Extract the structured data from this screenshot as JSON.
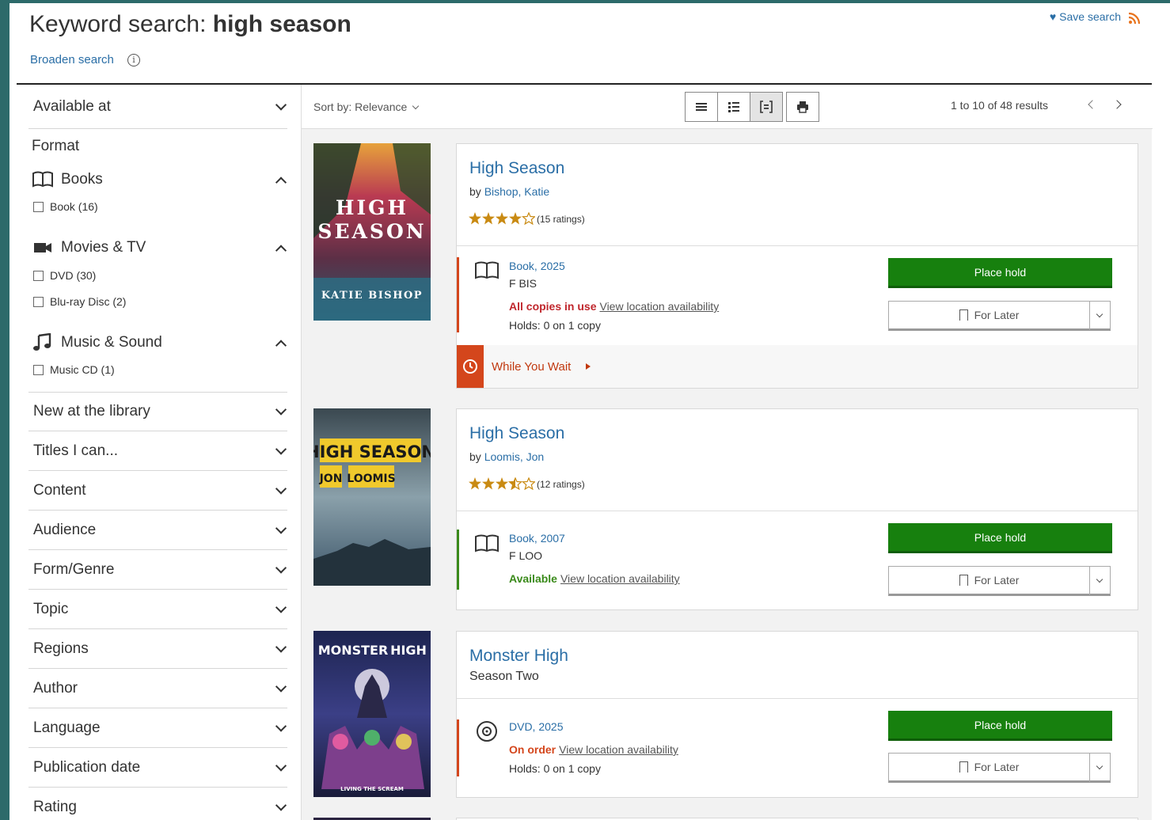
{
  "header": {
    "title_prefix": "Keyword search:",
    "title_query": "high season",
    "broaden_label": "Broaden search",
    "save_search_label": "Save search"
  },
  "sidebar": {
    "available_at": "Available at",
    "format_heading": "Format",
    "groups": [
      {
        "label": "Books",
        "options": [
          "Book (16)"
        ]
      },
      {
        "label": "Movies & TV",
        "options": [
          "DVD (30)",
          "Blu-ray Disc (2)"
        ]
      },
      {
        "label": "Music & Sound",
        "options": [
          "Music CD (1)"
        ]
      }
    ],
    "facets": [
      "New at the library",
      "Titles I can...",
      "Content",
      "Audience",
      "Form/Genre",
      "Topic",
      "Regions",
      "Author",
      "Language",
      "Publication date",
      "Rating"
    ]
  },
  "toolbar": {
    "sort_label": "Sort by: Relevance",
    "results_count": "1 to 10 of 48 results"
  },
  "results": [
    {
      "title": "High Season",
      "by_prefix": "by",
      "author": "Bishop, Katie",
      "rating_stars": 4,
      "ratings_text": "(15 ratings)",
      "format": "Book, 2025",
      "call_number": "F BIS",
      "status": "All copies in use",
      "status_color": "#c0272d",
      "availability_link": "View location availability",
      "holds": "Holds: 0 on 1 copy",
      "place_hold": "Place hold",
      "for_later": "For Later",
      "while_you_wait": "While You Wait",
      "cover_text": [
        "HIGH",
        "SEASON",
        "KATIE BISHOP"
      ]
    },
    {
      "title": "High Season",
      "by_prefix": "by",
      "author": "Loomis, Jon",
      "rating_stars": 3.5,
      "ratings_text": "(12 ratings)",
      "format": "Book, 2007",
      "call_number": "F LOO",
      "status": "Available",
      "status_color": "#3a8a1a",
      "availability_link": "View location availability",
      "place_hold": "Place hold",
      "for_later": "For Later",
      "cover_text": [
        "HIGH SEASON",
        "JON",
        "LOOMIS"
      ]
    },
    {
      "title": "Monster High",
      "subtitle": "Season Two",
      "format": "DVD, 2025",
      "status": "On order",
      "status_color": "#d4461c",
      "availability_link": "View location availability",
      "holds": "Holds: 0 on 1 copy",
      "place_hold": "Place hold",
      "for_later": "For Later",
      "cover_text": [
        "MONSTER",
        "HIGH",
        "LIVING THE SCREAM"
      ]
    }
  ],
  "colors": {
    "link": "#2a6ea6",
    "place_hold": "#17800e",
    "rss": "#e8731c"
  }
}
